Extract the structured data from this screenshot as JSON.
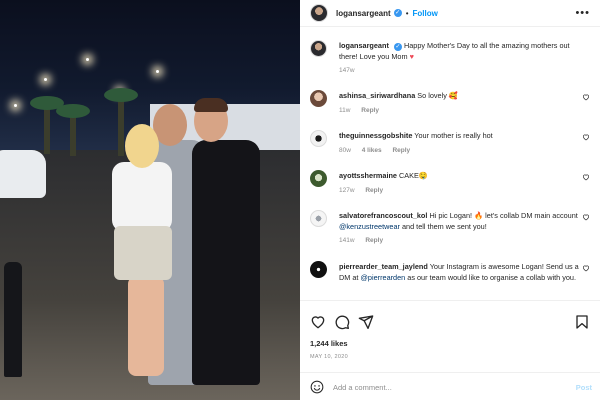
{
  "header": {
    "username": "logansargeant",
    "verified_badge": "✓",
    "separator": "•",
    "follow_label": "Follow",
    "more_label": "•••"
  },
  "caption": {
    "username": "logansargeant",
    "text": "Happy Mother's Day to all the amazing mothers out there! Love you Mom",
    "emoji": "♥",
    "time": "147w"
  },
  "comments": [
    {
      "username": "ashinsa_siriwardhana",
      "text": "So lovely 🥰",
      "time": "11w",
      "likes": "",
      "reply_label": "Reply"
    },
    {
      "username": "theguinnessgobshite",
      "text": "Your mother is really hot",
      "time": "80w",
      "likes": "4 likes",
      "reply_label": "Reply"
    },
    {
      "username": "ayottsshermaine",
      "text": "CAKE🤤",
      "time": "127w",
      "likes": "",
      "reply_label": "Reply"
    },
    {
      "username": "salvatorefrancoscout_kol",
      "text_before": "Hi pic Logan! 🔥 let's collab DM main account ",
      "mention": "@kenzustreetwear",
      "text_after": " and tell them we sent you!",
      "time": "141w",
      "likes": "",
      "reply_label": "Reply"
    },
    {
      "username": "pierrearder_team_jaylend",
      "text_before": "Your Instagram is awesome Logan! Send us a DM at ",
      "mention": "@pierrearden",
      "text_after": " as our team would like to organise a collab with you.",
      "time": "",
      "likes": "",
      "reply_label": ""
    }
  ],
  "actions": {
    "likes": "1,244 likes",
    "date": "MAY 10, 2020"
  },
  "add_comment": {
    "placeholder": "Add a comment...",
    "post_label": "Post"
  },
  "colors": {
    "accent": "#0095f6",
    "verified": "#3897f0",
    "muted": "#8e8e8e",
    "heart_red": "#ed4956",
    "post_disabled": "#b2dffc"
  },
  "icons": {
    "like": "heart-icon",
    "comment": "comment-bubble-icon",
    "share": "paper-plane-icon",
    "save": "bookmark-icon",
    "emoji": "smiley-icon"
  }
}
